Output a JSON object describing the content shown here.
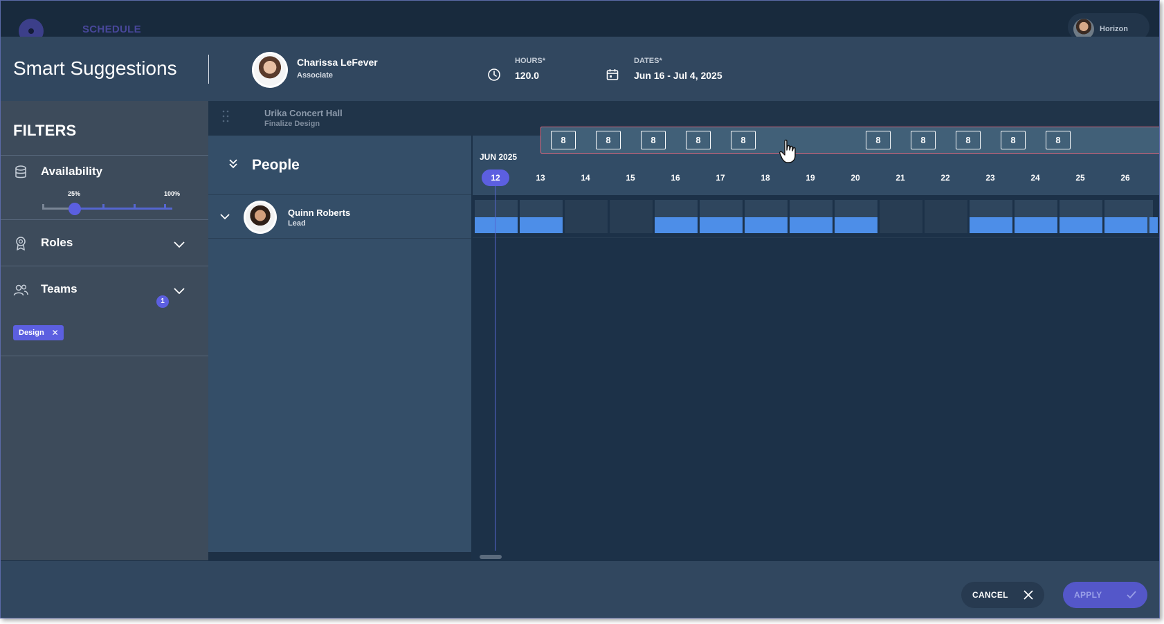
{
  "topbar": {
    "nav_label": "SCHEDULE",
    "user_name": "Horizon"
  },
  "header": {
    "title": "Smart Suggestions",
    "person_name": "Charissa LeFever",
    "person_role": "Associate",
    "hours_label": "HOURS*",
    "hours_value": "120.0",
    "dates_label": "DATES*",
    "dates_value": "Jun 16 - Jul 4, 2025"
  },
  "filters": {
    "title": "FILTERS",
    "availability": {
      "label": "Availability",
      "min_label": "25%",
      "max_label": "100%",
      "value_percent": 25
    },
    "roles": {
      "label": "Roles"
    },
    "teams": {
      "label": "Teams",
      "count": "1",
      "chips": [
        "Design"
      ]
    }
  },
  "project": {
    "name": "Urika Concert Hall",
    "task": "Finalize Design"
  },
  "people": {
    "title": "People",
    "rows": [
      {
        "name": "Quinn Roberts",
        "role": "Lead"
      }
    ]
  },
  "timeline": {
    "month": "JUN 2025",
    "today": "12",
    "days": [
      "12",
      "13",
      "14",
      "15",
      "16",
      "17",
      "18",
      "19",
      "20",
      "21",
      "22",
      "23",
      "24",
      "25",
      "26"
    ],
    "suggested_hours": [
      "8",
      "8",
      "8",
      "8",
      "8",
      "8",
      "8",
      "8",
      "8",
      "8"
    ]
  },
  "footer": {
    "cancel_label": "CANCEL",
    "apply_label": "APPLY"
  },
  "colors": {
    "accent": "#5c5fe0",
    "bar": "#4d8ee8",
    "highlight_border": "#d46a80"
  },
  "icons": {
    "hours": "clock-icon",
    "dates": "calendar-icon",
    "availability": "database-icon",
    "roles": "badge-icon",
    "teams": "users-icon",
    "cancel": "close-icon",
    "apply": "check-icon"
  }
}
